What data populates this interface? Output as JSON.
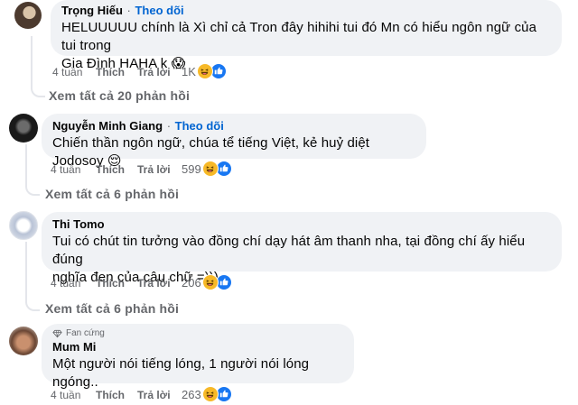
{
  "comments": [
    {
      "author": "Trọng Hiếu",
      "follow_label": "Theo dõi",
      "text_lines": [
        "HELUUUUU chính là Xì chỉ cả Tron đây hihihi tui đó Mn có hiểu ngôn ngữ của tui trong",
        "Gia Đình HAHA k"
      ],
      "emoji": "😱",
      "time": "4 tuần",
      "like_label": "Thích",
      "reply_label": "Trả lời",
      "reaction_count": "1K",
      "view_replies": "Xem tất cả 20 phản hồi"
    },
    {
      "author": "Nguyễn Minh Giang",
      "follow_label": "Theo dõi",
      "text_lines": [
        "Chiến thần ngôn ngữ, chúa tể tiếng Việt, kẻ huỷ diệt Jodosoy"
      ],
      "emoji": "😌",
      "time": "4 tuần",
      "like_label": "Thích",
      "reply_label": "Trả lời",
      "reaction_count": "599",
      "view_replies": "Xem tất cả 6 phản hồi"
    },
    {
      "author": "Thi Tomo",
      "text_lines": [
        "Tui có chút tin tưởng vào đồng chí dạy hát âm thanh nha, tại đồng chí ấy hiểu đúng",
        "nghĩa đen của câu chữ =)))"
      ],
      "time": "4 tuần",
      "like_label": "Thích",
      "reply_label": "Trả lời",
      "reaction_count": "206",
      "view_replies": "Xem tất cả 6 phản hồi"
    },
    {
      "badge": "Fan cứng",
      "author": "Mum Mi",
      "text_lines": [
        "Một người nói tiếng lóng, 1 người nói lóng ngóng.."
      ],
      "time": "4 tuần",
      "like_label": "Thích",
      "reply_label": "Trả lời",
      "reaction_count": "263"
    }
  ],
  "colors": {
    "bubble": "#f0f2f5",
    "link_blue": "#0064d1",
    "secondary_text": "#65676b",
    "like_blue": "#1877f2",
    "laugh_yellow": "#f7b928"
  },
  "icons": {
    "laugh_reaction": "laugh-reaction-icon",
    "like_reaction": "like-reaction-icon",
    "fan_badge": "diamond-icon"
  }
}
